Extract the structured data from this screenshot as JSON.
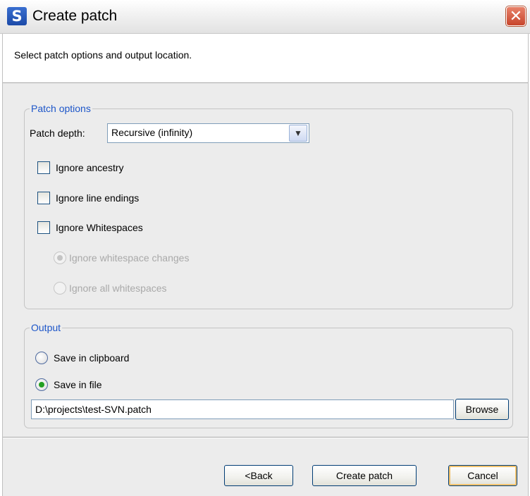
{
  "window": {
    "title": "Create patch",
    "app_icon_letter": "S",
    "close_glyph": "✕"
  },
  "header": {
    "description": "Select patch options and output location."
  },
  "patch_options": {
    "legend": "Patch options",
    "depth_label": "Patch depth:",
    "depth_value": "Recursive (infinity)",
    "ignore_ancestry": "Ignore ancestry",
    "ignore_line_endings": "Ignore line endings",
    "ignore_whitespaces": "Ignore Whitespaces",
    "ignore_whitespace_changes": "Ignore whitespace changes",
    "ignore_all_whitespaces": "Ignore all whitespaces"
  },
  "output": {
    "legend": "Output",
    "save_clipboard": "Save in clipboard",
    "save_file": "Save in file",
    "file_path": "D:\\projects\\test-SVN.patch",
    "browse": "Browse",
    "selected": "save_file"
  },
  "buttons": {
    "back": "<Back",
    "create": "Create patch",
    "cancel": "Cancel"
  },
  "icons": {
    "dropdown": "chevron-down-icon",
    "close": "close-icon"
  }
}
